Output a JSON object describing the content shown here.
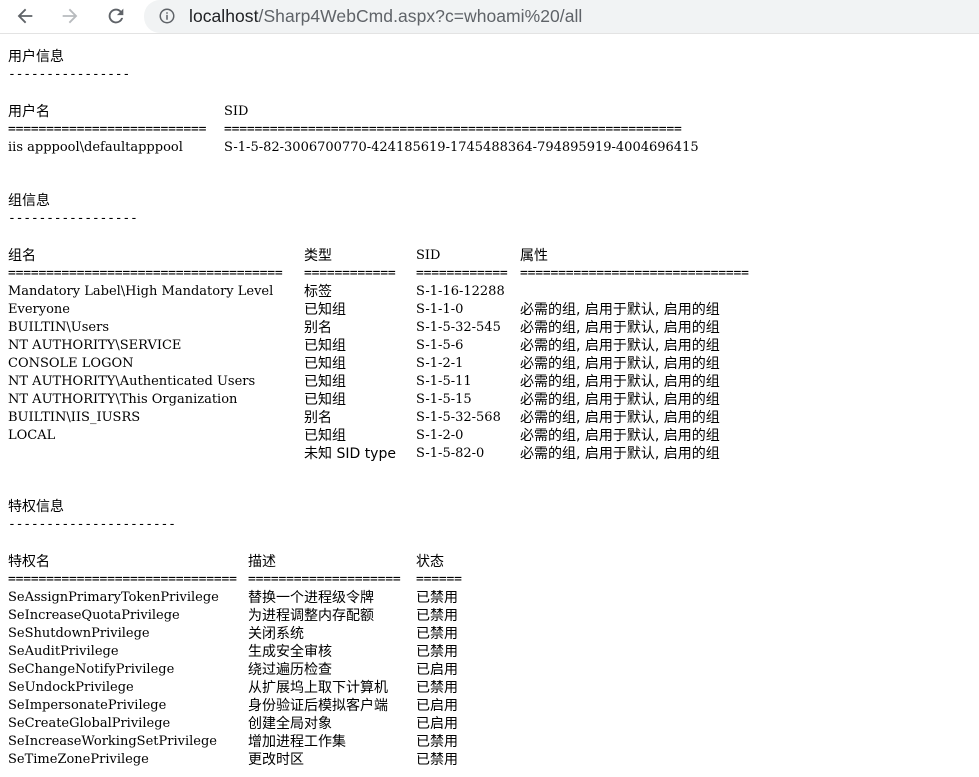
{
  "browser": {
    "url_host": "localhost",
    "url_path": "/Sharp4WebCmd.aspx?c=whoami%20/all"
  },
  "user_section": {
    "heading": "用户信息",
    "heading_rule": "----------------",
    "columns": [
      "用户名",
      "SID"
    ],
    "rules": [
      "==========================",
      "============================================================"
    ],
    "row": [
      "iis apppool\\defaultapppool",
      "S-1-5-82-3006700770-424185619-1745488364-794895919-4004696415"
    ]
  },
  "group_section": {
    "heading": "组信息",
    "heading_rule": "-----------------",
    "columns": [
      "组名",
      "类型",
      "SID",
      "属性"
    ],
    "rules": [
      "====================================",
      "============",
      "============",
      "=============================="
    ],
    "rows": [
      [
        "Mandatory Label\\High Mandatory Level",
        "标签",
        "S-1-16-12288",
        ""
      ],
      [
        "Everyone",
        "已知组",
        "S-1-1-0",
        "必需的组, 启用于默认, 启用的组"
      ],
      [
        "BUILTIN\\Users",
        "别名",
        "S-1-5-32-545",
        "必需的组, 启用于默认, 启用的组"
      ],
      [
        "NT AUTHORITY\\SERVICE",
        "已知组",
        "S-1-5-6",
        "必需的组, 启用于默认, 启用的组"
      ],
      [
        "CONSOLE LOGON",
        "已知组",
        "S-1-2-1",
        "必需的组, 启用于默认, 启用的组"
      ],
      [
        "NT AUTHORITY\\Authenticated Users",
        "已知组",
        "S-1-5-11",
        "必需的组, 启用于默认, 启用的组"
      ],
      [
        "NT AUTHORITY\\This Organization",
        "已知组",
        "S-1-5-15",
        "必需的组, 启用于默认, 启用的组"
      ],
      [
        "BUILTIN\\IIS_IUSRS",
        "别名",
        "S-1-5-32-568",
        "必需的组, 启用于默认, 启用的组"
      ],
      [
        "LOCAL",
        "已知组",
        "S-1-2-0",
        "必需的组, 启用于默认, 启用的组"
      ],
      [
        "",
        "未知 SID type",
        "S-1-5-82-0",
        "必需的组, 启用于默认, 启用的组"
      ]
    ]
  },
  "privilege_section": {
    "heading": "特权信息",
    "heading_rule": "----------------------",
    "columns": [
      "特权名",
      "描述",
      "状态"
    ],
    "rules": [
      "==============================",
      "====================",
      "======"
    ],
    "rows": [
      [
        "SeAssignPrimaryTokenPrivilege",
        "替换一个进程级令牌",
        "已禁用"
      ],
      [
        "SeIncreaseQuotaPrivilege",
        "为进程调整内存配额",
        "已禁用"
      ],
      [
        "SeShutdownPrivilege",
        "关闭系统",
        "已禁用"
      ],
      [
        "SeAuditPrivilege",
        "生成安全审核",
        "已禁用"
      ],
      [
        "SeChangeNotifyPrivilege",
        "绕过遍历检查",
        "已启用"
      ],
      [
        "SeUndockPrivilege",
        "从扩展坞上取下计算机",
        "已禁用"
      ],
      [
        "SeImpersonatePrivilege",
        "身份验证后模拟客户端",
        "已启用"
      ],
      [
        "SeCreateGlobalPrivilege",
        "创建全局对象",
        "已启用"
      ],
      [
        "SeIncreaseWorkingSetPrivilege",
        "增加进程工作集",
        "已禁用"
      ],
      [
        "SeTimeZonePrivilege",
        "更改时区",
        "已禁用"
      ]
    ]
  }
}
